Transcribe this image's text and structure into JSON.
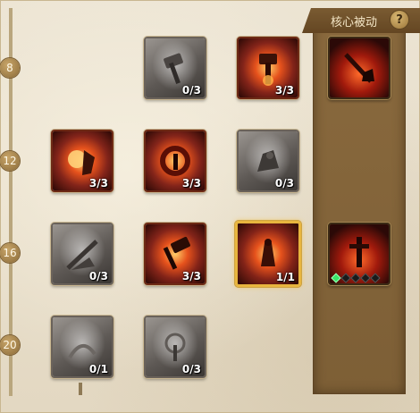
{
  "header": {
    "core_passive_label": "核心被动",
    "help_label": "?"
  },
  "tiers": [
    "8",
    "12",
    "16",
    "20"
  ],
  "talents": [
    {
      "id": "r1c2",
      "count": "0/3",
      "state": "locked",
      "icon": "rock-hammer-icon"
    },
    {
      "id": "r1c3",
      "count": "3/3",
      "state": "active",
      "icon": "fire-hammer-icon"
    },
    {
      "id": "r2c1",
      "count": "3/3",
      "state": "active",
      "icon": "fire-knight-icon"
    },
    {
      "id": "r2c2",
      "count": "3/3",
      "state": "active",
      "icon": "fire-ring-icon"
    },
    {
      "id": "r2c3",
      "count": "0/3",
      "state": "locked",
      "icon": "stone-warrior-icon"
    },
    {
      "id": "r3c1",
      "count": "0/3",
      "state": "locked",
      "icon": "stone-slash-icon"
    },
    {
      "id": "r3c2",
      "count": "3/3",
      "state": "active",
      "icon": "flame-hammer-icon"
    },
    {
      "id": "r3c3",
      "count": "1/1",
      "state": "selected",
      "icon": "fire-warrior-icon"
    },
    {
      "id": "r4c1",
      "count": "0/1",
      "state": "locked",
      "icon": "mist-icon"
    },
    {
      "id": "r4c2",
      "count": "0/3",
      "state": "locked",
      "icon": "storm-icon"
    }
  ],
  "core_passives": [
    {
      "id": "core1",
      "icon": "greatsword-icon"
    },
    {
      "id": "core2",
      "icon": "blood-sword-icon",
      "gems_total": 5,
      "gems_lit": 1
    }
  ],
  "colors": {
    "core_bg": "#7d5f36",
    "gem_lit": "#3be36a",
    "selected_border": "#e8b53e"
  }
}
